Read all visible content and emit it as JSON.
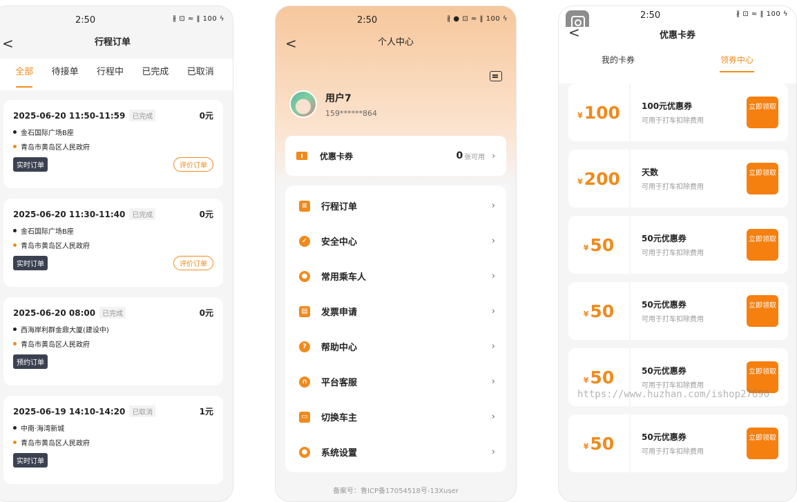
{
  "status": {
    "time": "2:50",
    "icons": "∦ ⊡ ≈ ‖ 100 ϟ",
    "icons_loc": "∦ ● ⊡ ≈ ‖ 100 ϟ"
  },
  "orders_screen": {
    "title": "行程订单",
    "back": "<",
    "tabs": [
      "全部",
      "待接单",
      "行程中",
      "已完成",
      "已取消"
    ],
    "orders": [
      {
        "date": "2025-06-20 11:50-11:59",
        "status": "已完成",
        "price": "0元",
        "from": "金石国际广场B座",
        "to": "青岛市黄岛区人民政府",
        "type": "实时订单",
        "action": "评价订单"
      },
      {
        "date": "2025-06-20 11:30-11:40",
        "status": "已完成",
        "price": "0元",
        "from": "金石国际广场B座",
        "to": "青岛市黄岛区人民政府",
        "type": "实时订单",
        "action": "评价订单"
      },
      {
        "date": "2025-06-20 08:00",
        "status": "已完成",
        "price": "0元",
        "from": "西海岸利群金鼎大厦(建设中)",
        "to": "青岛市黄岛区人民政府",
        "type": "预约订单",
        "action": ""
      },
      {
        "date": "2025-06-19 14:10-14:20",
        "status": "已取消",
        "price": "1元",
        "from": "中南·海湾新城",
        "to": "青岛市黄岛区人民政府",
        "type": "实时订单",
        "action": ""
      }
    ]
  },
  "profile_screen": {
    "title": "个人中心",
    "back": "<",
    "user": {
      "name": "用户7",
      "phone": "159******864"
    },
    "coupon": {
      "label": "优惠卡券",
      "count": "0",
      "unit": "张可用",
      "arrow": "›"
    },
    "menu": [
      {
        "label": "行程订单",
        "icon": "list-icon"
      },
      {
        "label": "安全中心",
        "icon": "shield-icon"
      },
      {
        "label": "常用乘车人",
        "icon": "person-icon"
      },
      {
        "label": "发票申请",
        "icon": "invoice-icon"
      },
      {
        "label": "帮助中心",
        "icon": "help-icon"
      },
      {
        "label": "平台客服",
        "icon": "headset-icon"
      },
      {
        "label": "切换车主",
        "icon": "car-icon"
      },
      {
        "label": "系统设置",
        "icon": "settings-icon"
      }
    ],
    "arrow": "›",
    "icp": "备案号：鲁ICP备17054518号-13Xuser"
  },
  "coupon_screen": {
    "title": "优惠卡券",
    "back": "<",
    "tabs": [
      "我的卡券",
      "领券中心"
    ],
    "currency": "¥",
    "claim_label": "立即领取",
    "coupons": [
      {
        "amount": "100",
        "name": "100元优惠券",
        "desc": "可用于打车扣除费用"
      },
      {
        "amount": "200",
        "name": "天数",
        "desc": "可用于打车扣除费用"
      },
      {
        "amount": "50",
        "name": "50元优惠券",
        "desc": "可用于打车扣除费用"
      },
      {
        "amount": "50",
        "name": "50元优惠券",
        "desc": "可用于打车扣除费用"
      },
      {
        "amount": "50",
        "name": "50元优惠券",
        "desc": "可用于打车扣除费用"
      },
      {
        "amount": "50",
        "name": "50元优惠券",
        "desc": "可用于打车扣除费用"
      }
    ]
  },
  "watermark": "https://www.huzhan.com/ishop27690",
  "colors": {
    "accent": "#f08a1c",
    "tag_dark": "#3b4150"
  }
}
